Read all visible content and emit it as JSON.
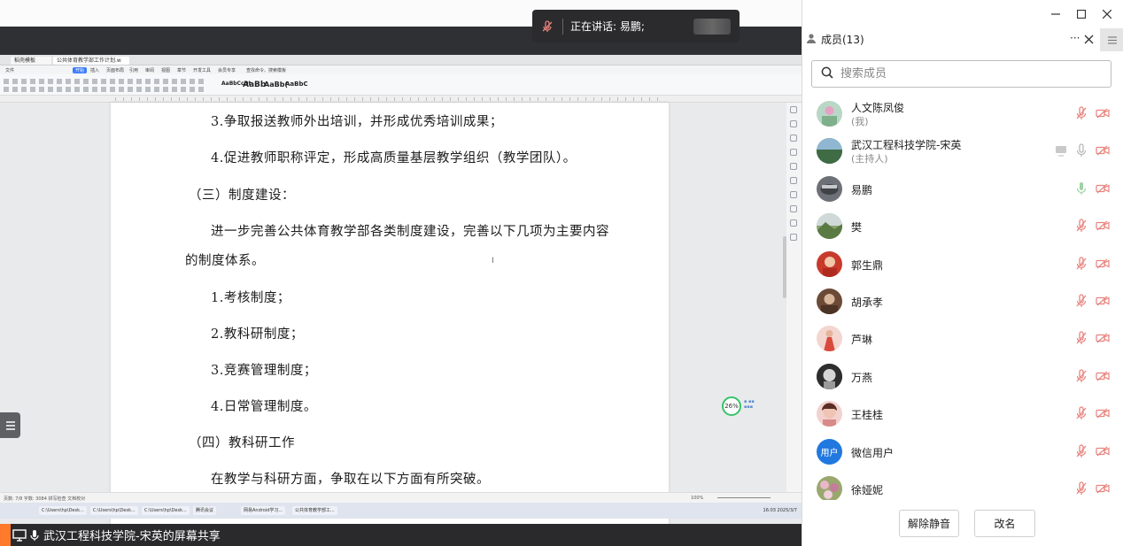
{
  "speaking_banner": {
    "text": "正在讲话: 易鹏;"
  },
  "document": {
    "tabs": [
      "稻壳模板",
      "公共体育教学部工作计划.w"
    ],
    "menu": [
      "文件",
      "开始",
      "插入",
      "页面布局",
      "引用",
      "审阅",
      "视图",
      "章节",
      "开发工具",
      "会员专享",
      "查找命令、搜索模板"
    ],
    "ribbon_styles": [
      "AaBbCcDt",
      "AaBb",
      "AaBb(",
      "AaBbC"
    ],
    "paragraphs": [
      "3.争取报送教师外出培训，并形成优秀培训成果；",
      "4.促进教师职称评定，形成高质量基层教学组织（教学团队）。",
      "（三）制度建设：",
      "进一步完善公共体育教学部各类制度建设，完善以下几项为主要内容",
      "的制度体系。",
      "1.考核制度；",
      "2.教科研制度；",
      "3.竞赛管理制度；",
      "4.日常管理制度。",
      "（四）教科研工作",
      "在教学与科研方面，争取在以下方面有所突破。"
    ],
    "progress_badge": "26%",
    "status_left": "页数: 7/8  字数: 3084  拼写检查  文档校对",
    "status_zoom": "100%",
    "taskbar_items": [
      "C:\\Users\\hp\\Desk...",
      "C:\\Users\\hp\\Desk...",
      "C:\\Users\\hp\\Desk...",
      "腾讯会议",
      "网易Android学习...",
      "公共体育教学部工..."
    ],
    "taskbar_time": "16:03\n2025/3/7"
  },
  "share_footer": {
    "label": "武汉工程科技学院-宋英的屏幕共享"
  },
  "panel": {
    "title": "成员(13)",
    "more": "···",
    "search_placeholder": "搜索成员",
    "members": [
      {
        "name": "人文陈凤俊",
        "sub": "(我)",
        "avatar_color": "#b9d7c6",
        "avatar_text": ""
      },
      {
        "name": "武汉工程科技学院-宋英",
        "sub": "(主持人)",
        "avatar_color": "#4f7d5e",
        "avatar_text": ""
      },
      {
        "name": "易鹏",
        "sub": "",
        "avatar_color": "#6d7076",
        "avatar_text": ""
      },
      {
        "name": "樊",
        "sub": "",
        "avatar_color": "#8aa36e",
        "avatar_text": ""
      },
      {
        "name": "郭生鼎",
        "sub": "",
        "avatar_color": "#c83a2c",
        "avatar_text": ""
      },
      {
        "name": "胡承孝",
        "sub": "",
        "avatar_color": "#6b4a36",
        "avatar_text": ""
      },
      {
        "name": "芦琳",
        "sub": "",
        "avatar_color": "#d94a3d",
        "avatar_text": ""
      },
      {
        "name": "万燕",
        "sub": "",
        "avatar_color": "#5a5a5a",
        "avatar_text": ""
      },
      {
        "name": "王桂桂",
        "sub": "",
        "avatar_color": "#d88a8a",
        "avatar_text": ""
      },
      {
        "name": "微信用户",
        "sub": "",
        "avatar_color": "#2179e0",
        "avatar_text": "用户"
      },
      {
        "name": "徐娅妮",
        "sub": "",
        "avatar_color": "#9aa86e",
        "avatar_text": ""
      }
    ],
    "buttons": {
      "unmute_all": "解除静音",
      "rename": "改名"
    }
  },
  "colors": {
    "accent": "#2179e0",
    "mic_muted": "#e8837d",
    "mic_on": "#9fd3a6",
    "green_ring": "#37c36a",
    "footer_orange": "#ff7b2b"
  }
}
